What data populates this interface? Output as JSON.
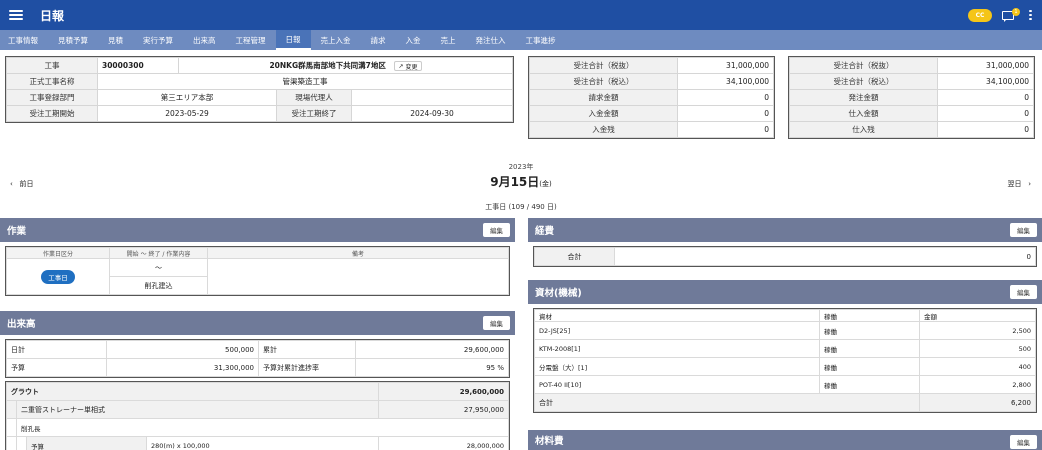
{
  "app": {
    "title": "日報",
    "user_badge": "CC",
    "notification_count": "1"
  },
  "tabs": [
    "工事情報",
    "見積予算",
    "見積",
    "実行予算",
    "出来高",
    "工程管理",
    "日報",
    "売上入金",
    "請求",
    "入金",
    "売上",
    "発注仕入",
    "工事進捗"
  ],
  "active_tab": "日報",
  "project": {
    "l_kouji": "工事",
    "code": "30000300",
    "name": "20NKG群馬南部地下共同溝7地区",
    "change_label": "変更",
    "l_seishiki": "正式工事名称",
    "formal_name": "管渠築造工事",
    "l_busho": "工事登録部門",
    "dept": "第三エリア本部",
    "l_dairi": "現場代理人",
    "agent": "",
    "l_start": "受注工期開始",
    "start": "2023-05-29",
    "l_end": "受注工期終了",
    "end": "2024-09-30"
  },
  "summary1": [
    [
      "受注合計（税抜）",
      "31,000,000"
    ],
    [
      "受注合計（税込）",
      "34,100,000"
    ],
    [
      "請求金額",
      "0"
    ],
    [
      "入金金額",
      "0"
    ],
    [
      "入金残",
      "0"
    ]
  ],
  "summary2": [
    [
      "受注合計（税抜）",
      "31,000,000"
    ],
    [
      "受注合計（税込）",
      "34,100,000"
    ],
    [
      "発注金額",
      "0"
    ],
    [
      "仕入金額",
      "0"
    ],
    [
      "仕入残",
      "0"
    ]
  ],
  "date": {
    "year": "2023年",
    "day": "9月15日",
    "weekday": "(金)",
    "prev": "前日",
    "next": "翌日",
    "workday": "工事日 (109 / 490 日)"
  },
  "edit_label": "編集",
  "work": {
    "title": "作業",
    "h1": "作業日区分",
    "h2": "開始 〜 終了 / 作業内容",
    "h3": "備考",
    "day_type": "工事日",
    "time": "〜",
    "content": "削孔建込",
    "note": ""
  },
  "output": {
    "title": "出来高",
    "daily_label": "日計",
    "daily": "500,000",
    "cum_label": "累計",
    "cum": "29,600,000",
    "budget_label": "予算",
    "budget": "31,300,000",
    "rate_label": "予算対累計進捗率",
    "rate": "95 %",
    "grout_label": "グラウト",
    "grout": "29,600,000",
    "sub_label": "二重管ストレーナー単相式",
    "sub": "27,950,000",
    "kou_label": "削孔長",
    "row_label": "予算",
    "row_detail": "280(m) x 100,000",
    "row_value": "28,000,000"
  },
  "expense": {
    "title": "経費",
    "total_label": "合計",
    "total": "0"
  },
  "materials": {
    "title": "資材(機械)",
    "h1": "資材",
    "h2": "稼働",
    "h3": "金額",
    "rows": [
      [
        "D2-JS[25]",
        "稼働",
        "2,500"
      ],
      [
        "KTM-2008[1]",
        "稼働",
        "500"
      ],
      [
        "分電盤（大）[1]",
        "稼働",
        "400"
      ],
      [
        "POT-40 II[10]",
        "稼働",
        "2,800"
      ]
    ],
    "total_label": "合計",
    "total": "6,200"
  },
  "material_cost": {
    "title": "材料費"
  }
}
